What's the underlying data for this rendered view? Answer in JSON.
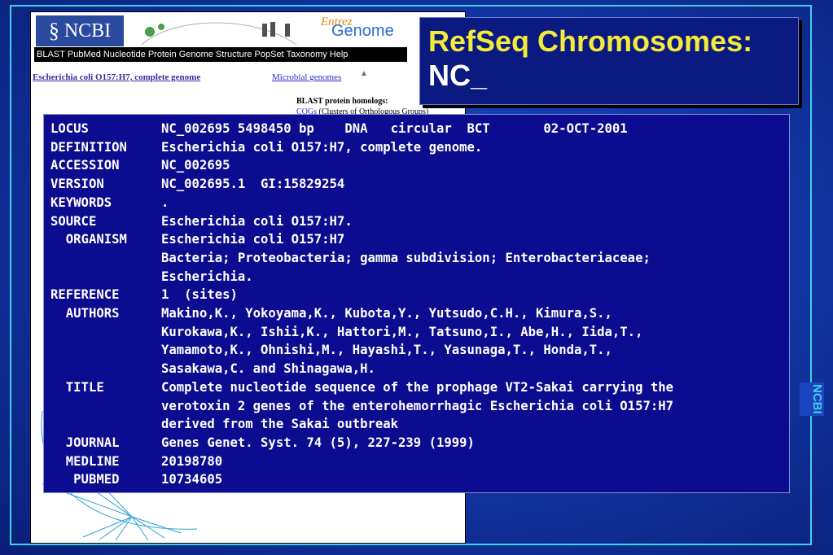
{
  "browser": {
    "logo_text": "NCBI",
    "entrez_text": "Entrez",
    "genome_text": "Genome",
    "nav_items": [
      "BLAST",
      "PubMed",
      "Nucleotide",
      "Protein",
      "Genome",
      "Structure",
      "PopSet",
      "Taxonomy",
      "Help"
    ],
    "genome_link": "Escherichia coli O157:H7, complete genome",
    "microbial_link": "Microbial genomes",
    "blast_heading": "BLAST protein homologs:",
    "cogs_link": "COGs",
    "cogs_text": " (Clusters of Orthologous Groups)"
  },
  "slide": {
    "title_line1": "RefSeq Chromosomes:",
    "title_line2": "NC_",
    "side_label": "NCBI",
    "colors": {
      "title": "#f4ea3a",
      "frame": "#3fd0e8",
      "record_bg": "#0c0c90"
    }
  },
  "record": {
    "lines": [
      {
        "key": "LOCUS",
        "value": "NC_002695 5498450 bp    DNA   circular  BCT       02-OCT-2001"
      },
      {
        "key": "DEFINITION",
        "value": "Escherichia coli O157:H7, complete genome."
      },
      {
        "key": "ACCESSION",
        "value": "NC_002695"
      },
      {
        "key": "VERSION",
        "value": "NC_002695.1  GI:15829254"
      },
      {
        "key": "KEYWORDS",
        "value": "."
      },
      {
        "key": "SOURCE",
        "value": "Escherichia coli O157:H7."
      },
      {
        "key": "  ORGANISM",
        "value": "Escherichia coli O157:H7"
      },
      {
        "key": "",
        "value": "Bacteria; Proteobacteria; gamma subdivision; Enterobacteriaceae;"
      },
      {
        "key": "",
        "value": "Escherichia."
      },
      {
        "key": "REFERENCE",
        "value": "1  (sites)"
      },
      {
        "key": "  AUTHORS",
        "value": "Makino,K., Yokoyama,K., Kubota,Y., Yutsudo,C.H., Kimura,S.,"
      },
      {
        "key": "",
        "value": "Kurokawa,K., Ishii,K., Hattori,M., Tatsuno,I., Abe,H., Iida,T.,"
      },
      {
        "key": "",
        "value": "Yamamoto,K., Ohnishi,M., Hayashi,T., Yasunaga,T., Honda,T.,"
      },
      {
        "key": "",
        "value": "Sasakawa,C. and Shinagawa,H."
      },
      {
        "key": "  TITLE",
        "value": "Complete nucleotide sequence of the prophage VT2-Sakai carrying the"
      },
      {
        "key": "",
        "value": "verotoxin 2 genes of the enterohemorrhagic Escherichia coli O157:H7"
      },
      {
        "key": "",
        "value": "derived from the Sakai outbreak"
      },
      {
        "key": "  JOURNAL",
        "value": "Genes Genet. Syst. 74 (5), 227-239 (1999)"
      },
      {
        "key": "  MEDLINE",
        "value": "20198780"
      },
      {
        "key": "   PUBMED",
        "value": "10734605"
      }
    ]
  }
}
